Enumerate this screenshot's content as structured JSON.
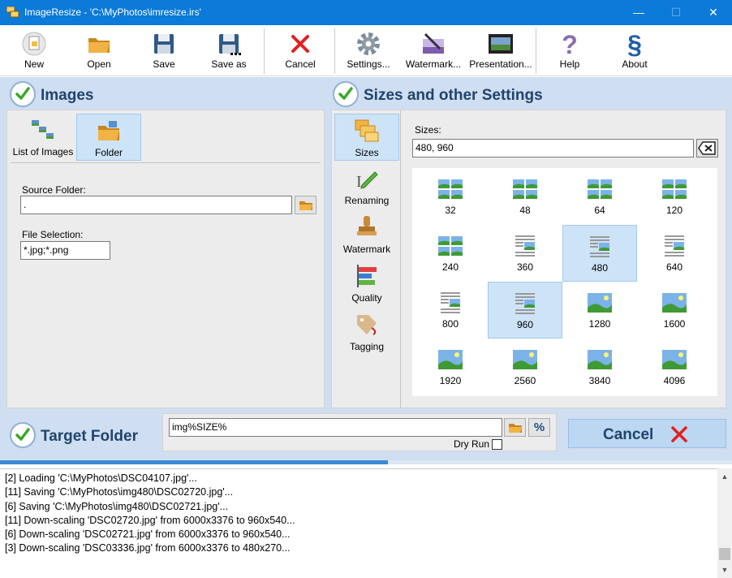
{
  "window": {
    "title": "ImageResize - 'C:\\MyPhotos\\imresize.irs'",
    "minimize": "—",
    "maximize": "☐",
    "close": "✕"
  },
  "toolbar": {
    "new": "New",
    "open": "Open",
    "save": "Save",
    "save_as": "Save as",
    "cancel": "Cancel",
    "settings": "Settings...",
    "watermark": "Watermark...",
    "presentation": "Presentation...",
    "help": "Help",
    "about": "About"
  },
  "images": {
    "heading": "Images",
    "tabs": {
      "list": "List of Images",
      "folder": "Folder"
    },
    "source_folder_label": "Source Folder:",
    "source_folder_value": ".",
    "file_selection_label": "File Selection:",
    "file_selection_value": "*.jpg;*.png"
  },
  "settings": {
    "heading": "Sizes and other Settings",
    "tabs": [
      "Sizes",
      "Renaming",
      "Watermark",
      "Quality",
      "Tagging"
    ],
    "sizes_label": "Sizes:",
    "sizes_value": "480, 960",
    "size_options": [
      "32",
      "48",
      "64",
      "120",
      "240",
      "360",
      "480",
      "640",
      "800",
      "960",
      "1280",
      "1600",
      "1920",
      "2560",
      "3840",
      "4096"
    ],
    "selected_sizes": [
      "480",
      "960"
    ]
  },
  "target": {
    "heading": "Target Folder",
    "value": "img%SIZE%",
    "percent_button": "%",
    "dry_run_label": "Dry Run",
    "dry_run_checked": false,
    "cancel_button": "Cancel"
  },
  "progress": {
    "fraction": 0.53
  },
  "log": [
    "[2] Loading 'C:\\MyPhotos\\DSC04107.jpg'...",
    "[11] Saving 'C:\\MyPhotos\\img480\\DSC02720.jpg'...",
    "[6] Saving 'C:\\MyPhotos\\img480\\DSC02721.jpg'...",
    "[11] Down-scaling 'DSC02720.jpg' from 6000x3376 to 960x540...",
    "[6] Down-scaling 'DSC02721.jpg' from 6000x3376 to 960x540...",
    "[3] Down-scaling 'DSC03336.jpg' from 6000x3376 to 480x270..."
  ],
  "colors": {
    "titlebar": "#0b7ad8",
    "section_bg": "#cfdef0",
    "heading_text": "#20446e",
    "selection": "#cde3f7",
    "cancel_red": "#e02020",
    "check_green": "#3aa829"
  }
}
